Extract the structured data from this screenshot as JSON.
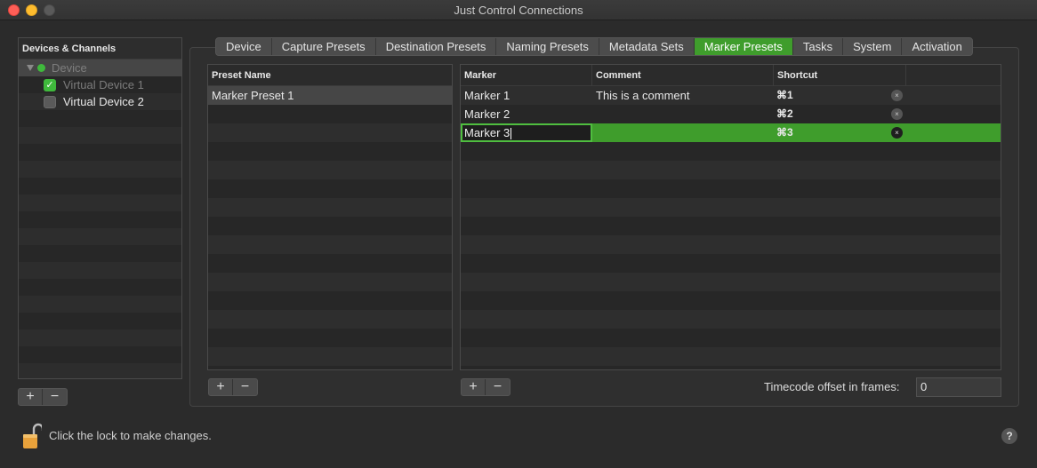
{
  "window": {
    "title": "Just Control Connections"
  },
  "sidebar": {
    "header": "Devices & Channels",
    "device": {
      "label": "Device",
      "status_color": "#3fb93c"
    },
    "channels": [
      {
        "label": "Virtual Device 1",
        "checked": true
      },
      {
        "label": "Virtual Device 2",
        "checked": false
      }
    ],
    "add_label": "+",
    "remove_label": "−"
  },
  "tabs": [
    {
      "label": "Device",
      "active": false
    },
    {
      "label": "Capture Presets",
      "active": false
    },
    {
      "label": "Destination Presets",
      "active": false
    },
    {
      "label": "Naming Presets",
      "active": false
    },
    {
      "label": "Metadata Sets",
      "active": false
    },
    {
      "label": "Marker Presets",
      "active": true
    },
    {
      "label": "Tasks",
      "active": false
    },
    {
      "label": "System",
      "active": false
    },
    {
      "label": "Activation",
      "active": false
    }
  ],
  "preset_table": {
    "header": "Preset Name",
    "rows": [
      "Marker Preset 1"
    ],
    "add_label": "+",
    "remove_label": "−"
  },
  "marker_table": {
    "headers": {
      "marker": "Marker",
      "comment": "Comment",
      "shortcut": "Shortcut"
    },
    "rows": [
      {
        "marker": "Marker 1",
        "comment": "This is a comment",
        "shortcut": "⌘1",
        "selected": false
      },
      {
        "marker": "Marker 2",
        "comment": "",
        "shortcut": "⌘2",
        "selected": false
      },
      {
        "marker": "Marker 3",
        "comment": "",
        "shortcut": "⌘3",
        "selected": true
      }
    ],
    "delete_glyph": "×",
    "add_label": "+",
    "remove_label": "−"
  },
  "timecode": {
    "label": "Timecode offset in frames:",
    "value": "0"
  },
  "footer": {
    "lock_text": "Click the lock to make changes.",
    "help_label": "?"
  },
  "colors": {
    "accent": "#3f9d2c",
    "selection_row": "#464646"
  }
}
